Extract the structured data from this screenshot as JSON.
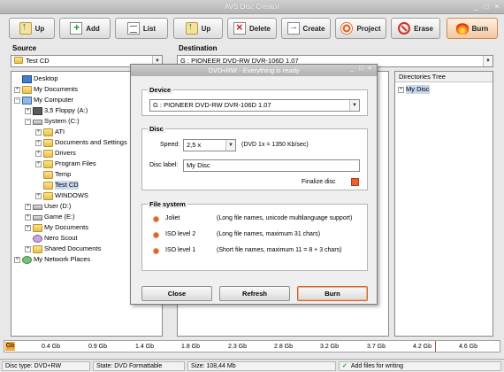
{
  "window": {
    "title": "AVS Disc Creator",
    "controls": [
      "_",
      "□",
      "×"
    ]
  },
  "toolbar": {
    "up_left": "Up",
    "add": "Add",
    "list": "List",
    "up_right": "Up",
    "delete": "Delete",
    "create": "Create",
    "project": "Project",
    "erase": "Erase",
    "burn": "Burn"
  },
  "source": {
    "label": "Source",
    "combo_value": "Test CD",
    "tree": [
      {
        "label": "Desktop",
        "icon": "desktop-icon"
      },
      {
        "label": "My Documents",
        "icon": "folder-icon"
      },
      {
        "label": "My Computer",
        "icon": "computer-icon"
      },
      {
        "label": "3,5 Floppy (A:)",
        "icon": "floppy-icon"
      },
      {
        "label": "System (C:)",
        "icon": "drive-icon"
      },
      {
        "label": "ATI",
        "icon": "folder-icon"
      },
      {
        "label": "Documents and Settings",
        "icon": "folder-icon"
      },
      {
        "label": "Drivers",
        "icon": "folder-icon"
      },
      {
        "label": "Program Files",
        "icon": "folder-icon"
      },
      {
        "label": "Temp",
        "icon": "folder-icon"
      },
      {
        "label": "Test CD",
        "icon": "folder-icon"
      },
      {
        "label": "WINDOWS",
        "icon": "folder-icon"
      },
      {
        "label": "User (D:)",
        "icon": "drive-icon"
      },
      {
        "label": "Game (E:)",
        "icon": "drive-icon"
      },
      {
        "label": "My Documents",
        "icon": "folder-icon"
      },
      {
        "label": "Nero Scout",
        "icon": "user-icon"
      },
      {
        "label": "Shared Documents",
        "icon": "folder-icon"
      },
      {
        "label": "My Network Places",
        "icon": "network-icon"
      }
    ]
  },
  "destination": {
    "label": "Destination",
    "combo_value": "G : PIONEER  DVD-RW  DVR-106D 1.07",
    "directories_header": "Directories Tree",
    "directories_root": "My Disc"
  },
  "dialog": {
    "title": "DVD+RW - Everything is ready",
    "device_label": "Device",
    "device_value": "G : PIONEER  DVD-RW  DVR-106D 1.07",
    "disc_label": "Disc",
    "speed_label": "Speed:",
    "speed_value": "2,5 x",
    "speed_note": "(DVD 1x = 1350 Kb/sec)",
    "disclabel_label": "Disc label:",
    "disclabel_value": "My Disc",
    "finalize_label": "Finalize disc",
    "filesystem_label": "File system",
    "options": [
      {
        "name": "Joliet",
        "desc": "(Long file names, unicode multilanguage support)"
      },
      {
        "name": "ISO level 2",
        "desc": "(Long file names, maximum 31 chars)"
      },
      {
        "name": "ISO level 1",
        "desc": "(Short file names, maximum 11  =  8 + 3 chars)"
      }
    ],
    "close": "Close",
    "refresh": "Refresh",
    "burn": "Burn"
  },
  "ruler": {
    "unit": "Gb",
    "ticks": [
      "0.4 Gb",
      "0.9 Gb",
      "1.4 Gb",
      "1.8 Gb",
      "2.3 Gb",
      "2.8 Gb",
      "3.2 Gb",
      "3.7 Gb",
      "4.2 Gb",
      "4.6 Gb"
    ]
  },
  "status": {
    "disc_type": "Disc type: DVD+RW",
    "state": "State: DVD Formattable",
    "size": "Size: 108,44 Mb",
    "hint": "Add files for writing"
  },
  "colors": {
    "accent": "#f07b3a",
    "finalize": "#e8602c",
    "selection": "#c8d8ee"
  }
}
